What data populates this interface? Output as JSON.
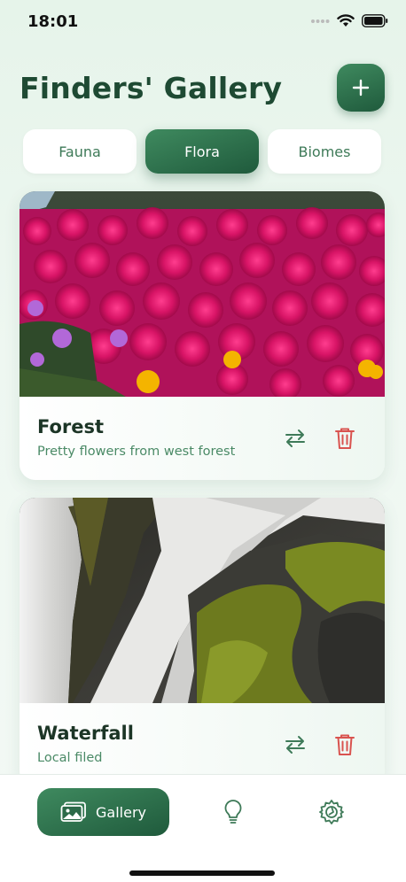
{
  "status_bar": {
    "time": "18:01"
  },
  "header": {
    "title": "Finders' Gallery",
    "add_icon": "plus-icon",
    "accent_color": "#2f6f4b"
  },
  "tabs": [
    {
      "label": "Fauna",
      "active": false
    },
    {
      "label": "Flora",
      "active": true
    },
    {
      "label": "Biomes",
      "active": false
    }
  ],
  "cards": [
    {
      "title": "Forest",
      "description": "Pretty flowers from west forest",
      "image": "pink-flowers-photo",
      "swap_icon": "swap-arrows-icon",
      "delete_icon": "trash-icon"
    },
    {
      "title": "Waterfall",
      "description": "Local filed",
      "image": "waterfall-moss-photo",
      "swap_icon": "swap-arrows-icon",
      "delete_icon": "trash-icon"
    }
  ],
  "bottom_nav": {
    "items": [
      {
        "label": "Gallery",
        "icon": "gallery-icon",
        "active": true
      },
      {
        "label": "",
        "icon": "lightbulb-icon",
        "active": false
      },
      {
        "label": "",
        "icon": "settings-icon",
        "active": false
      }
    ]
  },
  "colors": {
    "delete": "#d9534f",
    "swap": "#3e7a58"
  }
}
